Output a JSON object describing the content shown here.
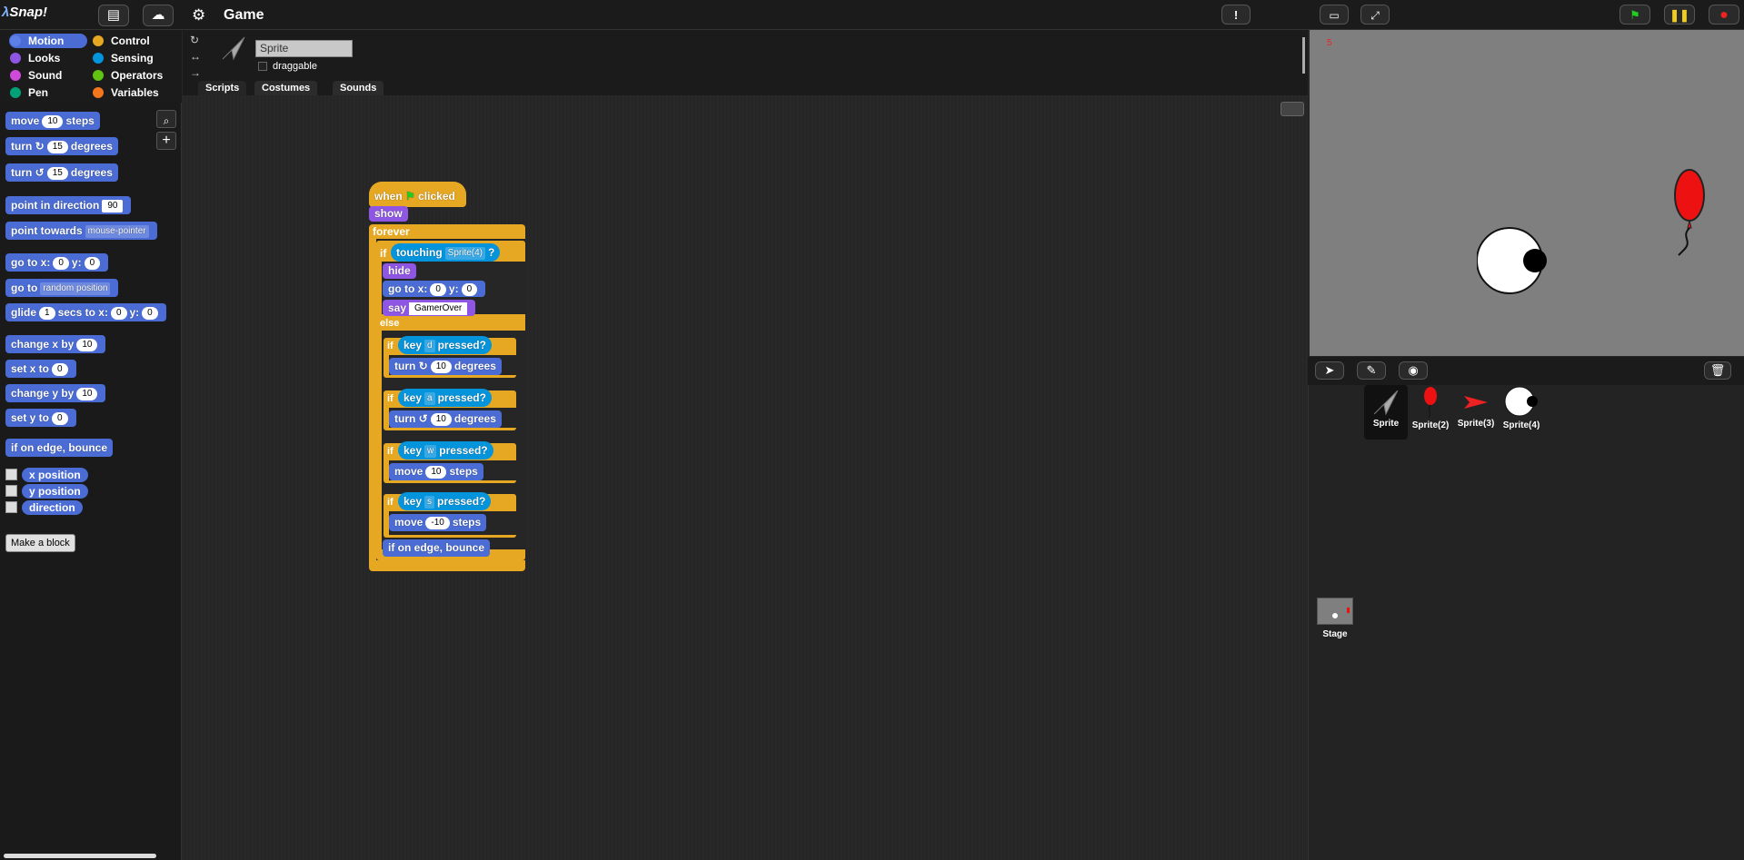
{
  "app": {
    "logo": "Snap!",
    "project_title": "Game"
  },
  "categories": [
    {
      "label": "Motion",
      "color": "#4a6cd4",
      "selected": true
    },
    {
      "label": "Control",
      "color": "#e6a822"
    },
    {
      "label": "Looks",
      "color": "#8f56e3"
    },
    {
      "label": "Sensing",
      "color": "#0494dc"
    },
    {
      "label": "Sound",
      "color": "#cf4ad9"
    },
    {
      "label": "Operators",
      "color": "#62c213"
    },
    {
      "label": "Pen",
      "color": "#00a178"
    },
    {
      "label": "Variables",
      "color": "#f3761d"
    }
  ],
  "palette": {
    "move": {
      "a": "move",
      "v": "10",
      "b": "steps"
    },
    "turn_cw": {
      "a": "turn",
      "icon": "↻",
      "v": "15",
      "b": "degrees"
    },
    "turn_ccw": {
      "a": "turn",
      "icon": "↺",
      "v": "15",
      "b": "degrees"
    },
    "point_dir": {
      "a": "point in direction",
      "v": "90"
    },
    "point_towards": {
      "a": "point towards",
      "v": "mouse-pointer"
    },
    "goto_xy": {
      "a": "go to x:",
      "x": "0",
      "b": "y:",
      "y": "0"
    },
    "goto": {
      "a": "go to",
      "v": "random position"
    },
    "glide": {
      "a": "glide",
      "s": "1",
      "b": "secs to x:",
      "x": "0",
      "c": "y:",
      "y": "0"
    },
    "change_x": {
      "a": "change x by",
      "v": "10"
    },
    "set_x": {
      "a": "set x to",
      "v": "0"
    },
    "change_y": {
      "a": "change y by",
      "v": "10"
    },
    "set_y": {
      "a": "set y to",
      "v": "0"
    },
    "bounce": "if on edge, bounce",
    "reporters": [
      "x position",
      "y position",
      "direction"
    ],
    "make_block": "Make a block"
  },
  "sprite": {
    "name": "Sprite",
    "draggable_label": "draggable"
  },
  "tabs": [
    "Scripts",
    "Costumes",
    "Sounds"
  ],
  "script": {
    "hat": {
      "a": "when",
      "b": "clicked"
    },
    "show": "show",
    "forever": "forever",
    "if": "if",
    "touching": {
      "a": "touching",
      "v": "Sprite(4)",
      "q": "?"
    },
    "hide": "hide",
    "goto": {
      "a": "go to x:",
      "x": "0",
      "b": "y:",
      "y": "0"
    },
    "say": {
      "a": "say",
      "v": "GamerOver"
    },
    "else": "else",
    "key_d": {
      "a": "key",
      "v": "d",
      "b": "pressed?"
    },
    "turn_cw": {
      "a": "turn",
      "v": "10",
      "b": "degrees"
    },
    "key_a": {
      "a": "key",
      "v": "a",
      "b": "pressed?"
    },
    "turn_ccw": {
      "a": "turn",
      "v": "10",
      "b": "degrees"
    },
    "key_w": {
      "a": "key",
      "v": "w",
      "b": "pressed?"
    },
    "move_fwd": {
      "a": "move",
      "v": "10",
      "b": "steps"
    },
    "key_s": {
      "a": "key",
      "v": "s",
      "b": "pressed?"
    },
    "move_back": {
      "a": "move",
      "v": "-10",
      "b": "steps"
    },
    "bounce": "if on edge, bounce"
  },
  "stage": {
    "counter": "5"
  },
  "corral": {
    "sprites": [
      "Sprite",
      "Sprite(2)",
      "Sprite(3)",
      "Sprite(4)"
    ],
    "stage_label": "Stage"
  }
}
